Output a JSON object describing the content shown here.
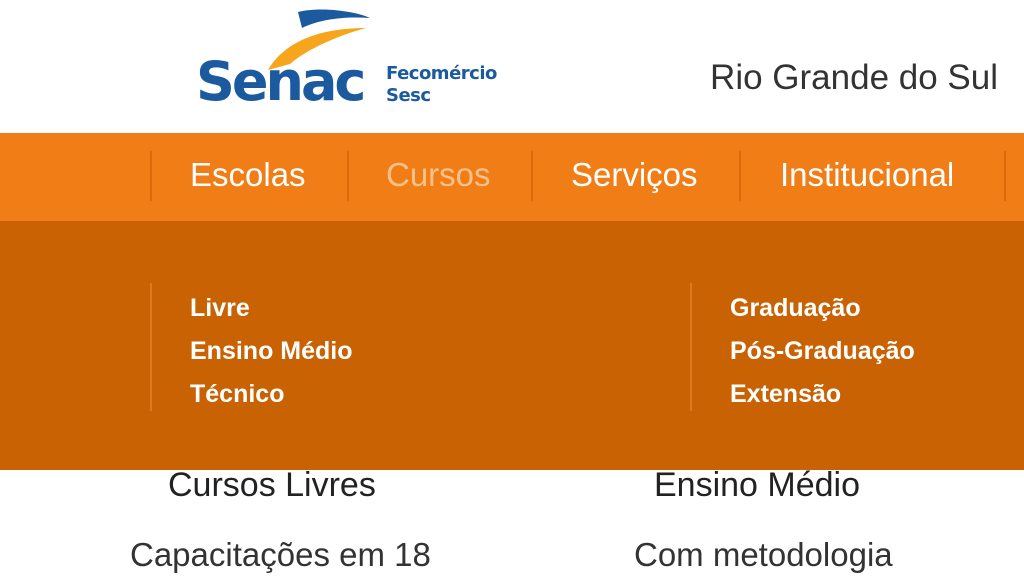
{
  "logo": {
    "name": "Senac",
    "line1": "Fecomércio",
    "line2": "Sesc"
  },
  "header": {
    "region": "Rio Grande do Sul"
  },
  "nav": {
    "items": [
      {
        "label": "Escolas"
      },
      {
        "label": "Cursos"
      },
      {
        "label": "Serviços"
      },
      {
        "label": "Institucional"
      }
    ],
    "active": "Cursos"
  },
  "dropdown": {
    "left": [
      "Livre",
      "Ensino Médio",
      "Técnico"
    ],
    "right": [
      "Graduação",
      "Pós-Graduação",
      "Extensão"
    ]
  },
  "cards": [
    {
      "title": "Cursos Livres",
      "text": "Capacitações em 18"
    },
    {
      "title": "Ensino Médio",
      "text": "Com metodologia"
    }
  ],
  "colors": {
    "nav_bg": "#f07d16",
    "dropdown_bg": "#c96203",
    "brand_blue": "#1b5a9f",
    "brand_orange": "#f7a51c"
  }
}
